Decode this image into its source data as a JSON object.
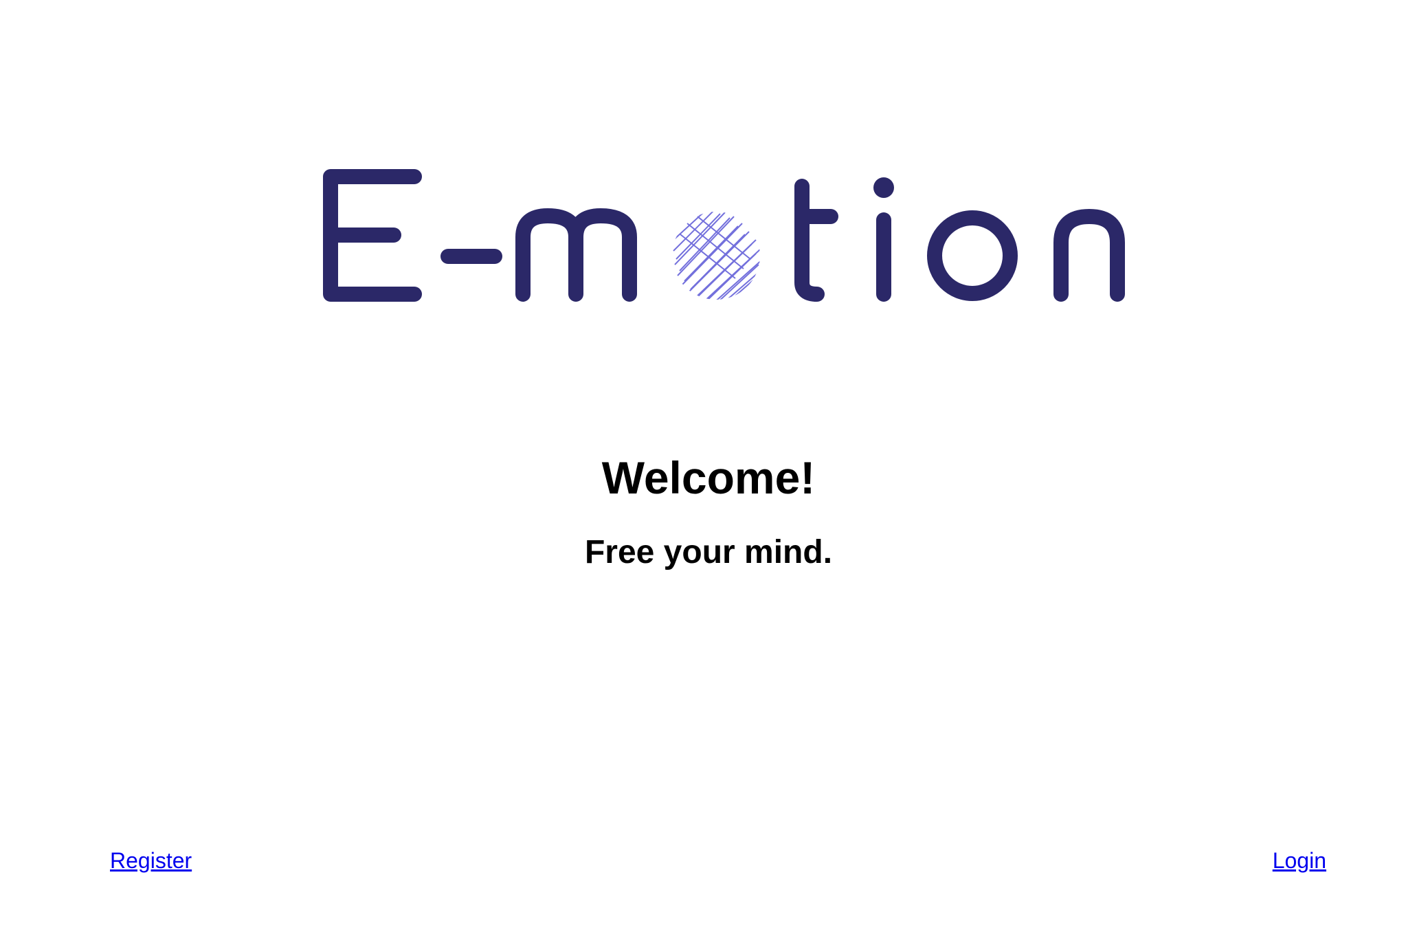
{
  "logo": {
    "text": "E-motion",
    "letter_color": "#2b2868",
    "scribble_color": "#5b57d6"
  },
  "hero": {
    "title": "Welcome!",
    "subtitle": "Free your mind."
  },
  "nav": {
    "register_label": "Register",
    "login_label": "Login",
    "link_color": "#0000ee"
  }
}
